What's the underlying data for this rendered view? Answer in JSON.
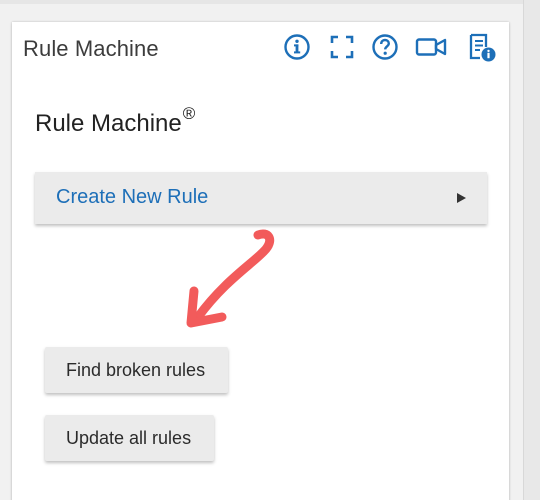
{
  "card": {
    "title": "Rule Machine"
  },
  "toolbar": {
    "icons": [
      "info-circle-icon",
      "fullscreen-icon",
      "help-circle-icon",
      "video-camera-icon",
      "document-info-icon"
    ],
    "accent_color": "#1d6fb8"
  },
  "main": {
    "app_name": "Rule Machine",
    "registered_mark": "®",
    "create_rule_label": "Create New Rule",
    "find_broken_label": "Find broken rules",
    "update_all_label": "Update all rules"
  },
  "annotation": {
    "arrow_color": "#f25b5b"
  }
}
